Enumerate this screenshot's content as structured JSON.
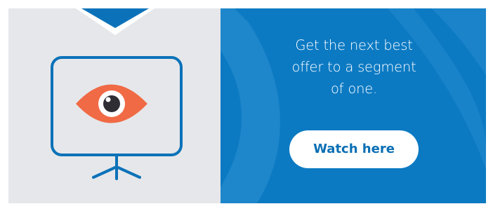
{
  "banner": {
    "headline": "Get the next best offer to a segment of one.",
    "headline_lines": [
      "Get the next best",
      "offer to a segment",
      "of one."
    ],
    "cta_label": "Watch here"
  },
  "icons": {
    "illustration": "presentation-screen-with-eye-icon"
  },
  "colors": {
    "left_background": "#e6e7ea",
    "right_background": "#0c7ac3",
    "accent_blue": "#0b72b9",
    "eye_orange": "#f06a45",
    "button_background": "#ffffff",
    "button_text": "#0a6fb4"
  }
}
